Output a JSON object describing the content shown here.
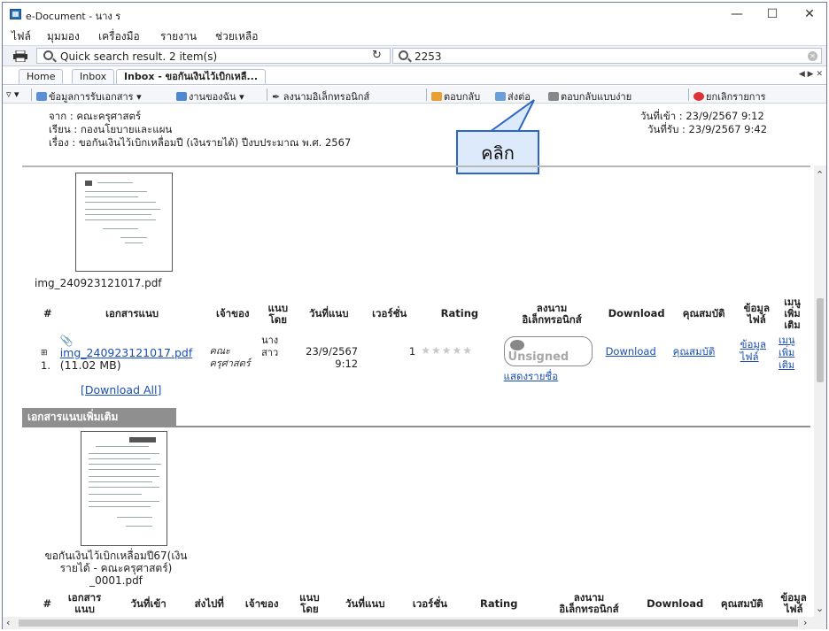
{
  "window": {
    "title": "e-Document - นาง ร",
    "minimize": "—",
    "maximize": "☐",
    "close": "✕"
  },
  "menu": [
    "ไฟล์",
    "มุมมอง",
    "เครื่องมือ",
    "รายงาน",
    "ช่วยเหลือ"
  ],
  "search": {
    "label": "Quick search result. 2 item(s)",
    "query": "2253"
  },
  "breadcrumb": {
    "home": "Home",
    "inbox": "Inbox",
    "current": "Inbox - ขอกันเงินไว้เบิกเหลื..."
  },
  "actions": {
    "doc_info": "ข้อมูลการรับเอกสาร",
    "my_work": "งานของฉัน",
    "e_sign": "ลงนามอิเล็กทรอนิกส์",
    "reply": "ตอบกลับ",
    "forward": "ส่งต่อ",
    "quick_reply": "ตอบกลับแบบง่าย",
    "cancel": "ยกเลิกรายการ"
  },
  "header": {
    "from": "จาก : คณะครุศาสตร์",
    "to": "เรียน : กองนโยบายและแผน",
    "subject": "เรื่อง : ขอกันเงินไว้เบิกเหลื่อมปี (เงินรายได้) ปีงบประมาณ พ.ศ. 2567",
    "date_in": "วันที่เข้า : 23/9/2567 9:12",
    "date_received": "วันที่รับ : 23/9/2567 9:42"
  },
  "callout": "คลิก",
  "main_file": {
    "caption": "img_240923121017.pdf"
  },
  "attach_table": {
    "headers": [
      "#",
      "เอกสารแนบ",
      "เจ้าของ",
      "แนบ\nโดย",
      "วันที่แนบ",
      "เวอร์ชั่น",
      "Rating",
      "ลงนาม\nอิเล็กทรอนิกส์",
      "Download",
      "คุณสมบัติ",
      "ข้อมูล\nไฟล์",
      "เมนู\nเพิ่ม\nเติม"
    ],
    "row": {
      "num": "1.",
      "filename": "img_240923121017.pdf",
      "size": "(11.02 MB)",
      "owner": "คณะ\nครุศาสตร์",
      "attached_by": "นาง\nสาว",
      "date": "23/9/2567\n9:12",
      "version": "1",
      "stars": "★★★★★",
      "signed": "Unsigned",
      "show_names": "แสดงรายชื่อ",
      "download": "Download",
      "props": "คุณสมบัติ",
      "file_info": "ข้อมูล\nไฟล์",
      "more": "เมนู\nเพิ่ม\nเติม"
    },
    "download_all": "[Download All]"
  },
  "extra_section": {
    "title": "เอกสารแนบเพิ่มเติม",
    "file_caption": "ขอกันเงินไว้เบิกเหลื่อมปี67(เงิน\nรายได้ - คณะครุศาสตร์)\n_0001.pdf",
    "headers": [
      "#",
      "เอกสาร\nแนบ",
      "วันที่เข้า",
      "ส่งไปที่",
      "เจ้าของ",
      "แนบ\nโดย",
      "วันที่แนบ",
      "เวอร์ชั่น",
      "Rating",
      "ลงนาม\nอิเล็กทรอนิกส์",
      "Download",
      "คุณสมบัติ",
      "ข้อมูล\nไฟล์"
    ]
  }
}
